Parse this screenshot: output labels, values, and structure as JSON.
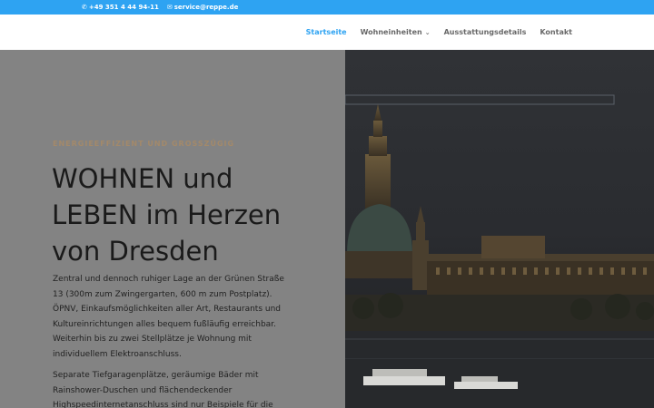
{
  "topbar": {
    "phone": "+49 351 4 44 94-11",
    "email": "service@reppe.de",
    "bg_color": "#2ea3f2"
  },
  "nav": {
    "items": [
      {
        "label": "Startseite",
        "active": true
      },
      {
        "label": "Wohneinheiten",
        "has_dropdown": true
      },
      {
        "label": "Ausstattungsdetails"
      },
      {
        "label": "Kontakt"
      }
    ],
    "accent_color": "#2ea3f2"
  },
  "hero": {
    "eyebrow": "ENERGIEEFFIZIENT UND GROSSZÜGIG",
    "headline_line1": "WOHNEN und",
    "headline_line2": "LEBEN im Herzen",
    "headline_line3": "von Dresden",
    "paragraph1": "Zentral und dennoch ruhiger Lage an der Grünen Straße 13 (300m zum Zwingergarten, 600 m zum Postplatz). ÖPNV, Einkaufsmöglichkeiten aller Art, Restaurants und Kultureinrichtungen alles bequem fußläufig erreichbar. Weiterhin bis zu zwei Stellplätze je Wohnung mit individuellem Elektroanschluss.",
    "paragraph2": "Separate Tiefgaragenplätze, geräumige Bäder mit Rainshower-Duschen und flächendeckender Highspeedinternetanschluss sind nur Beispiele für die"
  },
  "icons": {
    "phone": "phone-icon",
    "email": "envelope-icon",
    "dropdown": "chevron-down-icon"
  }
}
